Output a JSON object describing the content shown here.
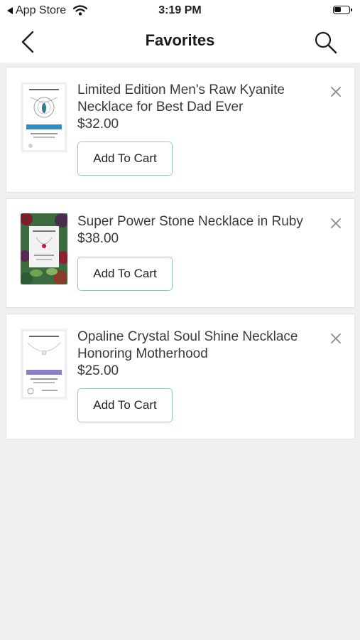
{
  "status_bar": {
    "back_app_label": "App Store",
    "time": "3:19 PM"
  },
  "header": {
    "title": "Favorites"
  },
  "colors": {
    "button_border": "#8fc7c3",
    "card_background": "#ffffff",
    "page_background": "#efefef"
  },
  "favorites": [
    {
      "name": "Limited Edition Men's Raw Kyanite Necklace for Best Dad Ever",
      "price": "$32.00",
      "button_label": "Add To Cart"
    },
    {
      "name": "Super Power Stone Necklace in Ruby",
      "price": "$38.00",
      "button_label": "Add To Cart"
    },
    {
      "name": "Opaline Crystal Soul Shine Necklace Honoring Motherhood",
      "price": "$25.00",
      "button_label": "Add To Cart"
    }
  ]
}
